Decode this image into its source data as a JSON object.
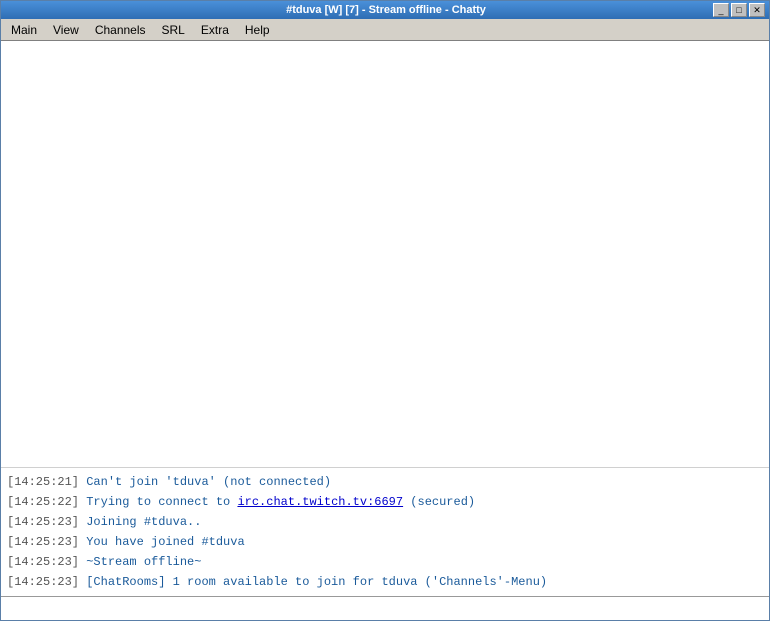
{
  "window": {
    "title": "#tduva [W] [7] - Stream offline - Chatty",
    "app_name": "Chatty"
  },
  "title_bar": {
    "text": "#tduva [W] [7] - Stream offline - Chatty",
    "minimize_label": "_",
    "maximize_label": "□",
    "close_label": "✕"
  },
  "menu": {
    "items": [
      {
        "id": "main",
        "label": "Main"
      },
      {
        "id": "view",
        "label": "View"
      },
      {
        "id": "channels",
        "label": "Channels"
      },
      {
        "id": "srl",
        "label": "SRL"
      },
      {
        "id": "extra",
        "label": "Extra"
      },
      {
        "id": "help",
        "label": "Help"
      }
    ]
  },
  "messages": [
    {
      "id": 1,
      "timestamp": "[14:25:21]",
      "text": " Can't join 'tduva' (not connected)",
      "has_link": false
    },
    {
      "id": 2,
      "timestamp": "[14:25:22]",
      "text_before": " Trying to connect to ",
      "link_text": "irc.chat.twitch.tv:6697",
      "link_href": "irc.chat.twitch.tv:6697",
      "text_after": " (secured)",
      "has_link": true
    },
    {
      "id": 3,
      "timestamp": "[14:25:23]",
      "text": " Joining #tduva..",
      "has_link": false
    },
    {
      "id": 4,
      "timestamp": "[14:25:23]",
      "text": " You have joined #tduva",
      "has_link": false
    },
    {
      "id": 5,
      "timestamp": "[14:25:23]",
      "text": " ~Stream offline~",
      "has_link": false
    },
    {
      "id": 6,
      "timestamp": "[14:25:23]",
      "text": " [ChatRooms] 1 room available to join for tduva ('Channels'-Menu)",
      "has_link": false
    }
  ],
  "input": {
    "placeholder": "",
    "value": ""
  }
}
